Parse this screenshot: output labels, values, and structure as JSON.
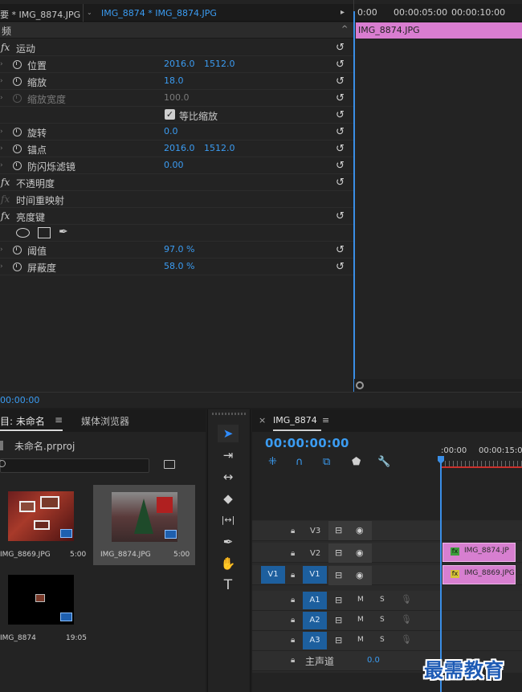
{
  "effect_controls": {
    "tab_source": "要 * IMG_8874.JPG",
    "tab_active": "IMG_8874 * IMG_8874.JPG",
    "tab_menu": "▸",
    "header_label": "频",
    "header_caret": "^",
    "ruler_labels": [
      "0:00",
      "00:00:05:00",
      "00:00:10:00"
    ],
    "clip_label": "IMG_8874.JPG",
    "footer_timecode": "00:00:00",
    "rows": {
      "motion": "运动",
      "position": {
        "label": "位置",
        "x": "2016.0",
        "y": "1512.0"
      },
      "scale": {
        "label": "缩放",
        "value": "18.0"
      },
      "scale_width": {
        "label": "缩放宽度",
        "value": "100.0"
      },
      "uniform_scale": {
        "label": "等比缩放",
        "check": "✓"
      },
      "rotation": {
        "label": "旋转",
        "value": "0.0"
      },
      "anchor": {
        "label": "锚点",
        "x": "2016.0",
        "y": "1512.0"
      },
      "antiflicker": {
        "label": "防闪烁滤镜",
        "value": "0.00"
      },
      "opacity": "不透明度",
      "time_remap": "时间重映射",
      "luma_key": "亮度键",
      "threshold": {
        "label": "阈值",
        "value": "97.0 %"
      },
      "cutoff": {
        "label": "屏蔽度",
        "value": "58.0 %"
      }
    },
    "fx_glyph": "fx",
    "reset_glyph": "↺"
  },
  "project": {
    "tab_project": "目: 未命名",
    "tab_menu": "≡",
    "tab_media": "媒体浏览器",
    "file_name": "未命名.prproj",
    "search_placeholder": "",
    "items": [
      {
        "name": "IMG_8869.JPG",
        "duration": "5:00"
      },
      {
        "name": "IMG_8874.JPG",
        "duration": "5:00"
      },
      {
        "name": "IMG_8874",
        "duration": "19:05"
      }
    ]
  },
  "tools": {
    "selection": "➤",
    "track_select": "⇥",
    "ripple": "↔",
    "razor": "◆",
    "slip": "|↔|",
    "pen": "✒",
    "hand": "✋",
    "type": "T"
  },
  "timeline": {
    "close": "×",
    "sequence_name": "IMG_8874",
    "menu": "≡",
    "timecode": "00:00:00:00",
    "ruler_labels": [
      ":00:00",
      "00:00:15:00"
    ],
    "tracks_video": [
      {
        "name": "V3"
      },
      {
        "name": "V2",
        "clip": "IMG_8874.JP"
      },
      {
        "name": "V1",
        "source": "V1",
        "clip": "IMG_8869.JPG"
      }
    ],
    "tracks_audio": [
      {
        "name": "A1",
        "m": "M",
        "s": "S"
      },
      {
        "name": "A2",
        "m": "M",
        "s": "S"
      },
      {
        "name": "A3",
        "m": "M",
        "s": "S"
      }
    ],
    "master_label": "主声道",
    "master_value": "0.0",
    "fx_badge": "fx"
  },
  "watermark": "最需教育"
}
